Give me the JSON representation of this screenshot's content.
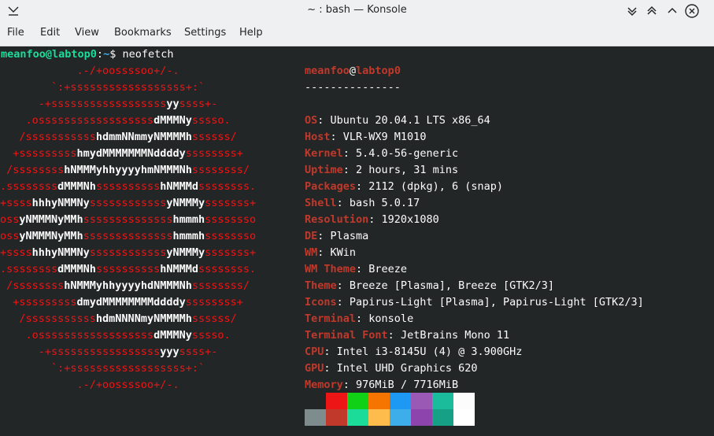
{
  "window": {
    "title": "~ : bash — Konsole"
  },
  "titlebar_icons": {
    "app": "konsole-icon",
    "minimize": "chevron-down-icon",
    "maximize": "chevron-up-icon",
    "close": "close-icon",
    "extra": "circle-icon"
  },
  "menu": [
    "File",
    "Edit",
    "View",
    "Bookmarks",
    "Settings",
    "Help"
  ],
  "prompt": {
    "user_host": "meanfoo@labtop0",
    "sep": ":",
    "path": "~",
    "symbol": "$",
    "command": " neofetch"
  },
  "ascii": [
    "            .-/+oossssoo+/-.",
    "        `:+ssssssssssssssssss+:`",
    "      -+ssssssssssssssssssyyssss+-",
    "    .ossssssssssssssssssdMMMNysssso.",
    "   /ssssssssssshdmmNNmmyNMMMMhssssss/",
    "  +ssssssssshmydMMMMMMMNddddyssssssss+",
    " /sssssssshNMMMyhhyyyyhmNMMMNhssssssss/",
    ".ssssssssdMMMNhsssssssssshNMMMdssssssss.",
    "+sssshhhyNMMNyssssssssssssyNMMMysssssss+",
    "ossyNMMMNyMMhsssssssssssssshmmmhssssssso",
    "ossyNMMMNyMMhsssssssssssssshmmmhssssssso",
    "+sssshhhyNMMNyssssssssssssyNMMMysssssss+",
    ".ssssssssdMMMNhsssssssssshNMMMdssssssss.",
    " /sssssssshNMMMyhhyyyyhdNMMMNhssssssss/",
    "  +sssssssssdmydMMMMMMMMddddyssssssss+",
    "   /ssssssssssshdmNNNNmyNMMMMhssssss/",
    "    .ossssssssssssssssssdMMMNysssso.",
    "      -+sssssssssssssssssyyyssss+-",
    "        `:+ssssssssssssssssss+:`",
    "            .-/+oossssoo+/-."
  ],
  "info_header": {
    "user": "meanfoo",
    "at": "@",
    "host": "labtop0",
    "separator": "---------------"
  },
  "info": [
    {
      "key": "OS",
      "value": "Ubuntu 20.04.1 LTS x86_64"
    },
    {
      "key": "Host",
      "value": "VLR-WX9 M1010"
    },
    {
      "key": "Kernel",
      "value": "5.4.0-56-generic"
    },
    {
      "key": "Uptime",
      "value": "2 hours, 31 mins"
    },
    {
      "key": "Packages",
      "value": "2112 (dpkg), 6 (snap)"
    },
    {
      "key": "Shell",
      "value": "bash 5.0.17"
    },
    {
      "key": "Resolution",
      "value": "1920x1080"
    },
    {
      "key": "DE",
      "value": "Plasma"
    },
    {
      "key": "WM",
      "value": "KWin"
    },
    {
      "key": "WM Theme",
      "value": "Breeze"
    },
    {
      "key": "Theme",
      "value": "Breeze [Plasma], Breeze [GTK2/3]"
    },
    {
      "key": "Icons",
      "value": "Papirus-Light [Plasma], Papirus-Light [GTK2/3]"
    },
    {
      "key": "Terminal",
      "value": "konsole"
    },
    {
      "key": "Terminal Font",
      "value": "JetBrains Mono 11"
    },
    {
      "key": "CPU",
      "value": "Intel i3-8145U (4) @ 3.900GHz"
    },
    {
      "key": "GPU",
      "value": "Intel UHD Graphics 620"
    },
    {
      "key": "Memory",
      "value": "976MiB / 7716MiB"
    }
  ],
  "colors": {
    "row1": [
      "#232627",
      "#ed1515",
      "#11d116",
      "#f67400",
      "#1d99f3",
      "#9b59b6",
      "#1abc9c",
      "#fcfcfc"
    ],
    "row2": [
      "#7f8c8d",
      "#c0392b",
      "#1cdc9a",
      "#fdbc4b",
      "#3daee9",
      "#8e44ad",
      "#16a085",
      "#ffffff"
    ]
  }
}
